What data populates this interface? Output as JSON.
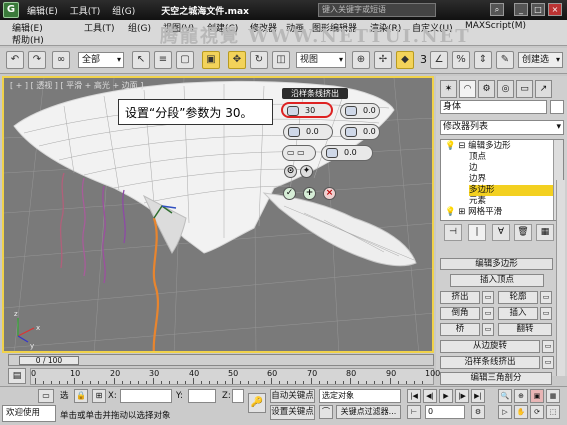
{
  "window": {
    "logo": "G",
    "menu": [
      "编辑(E)",
      "工具(T)",
      "组(G)",
      "视图(V)",
      "创建(C)",
      "修改器",
      "动画",
      "图形编辑器",
      "渲染(R)",
      "自定义(U)",
      "MAXScript(M)"
    ],
    "help_menu": "帮助(H)",
    "file_title": "天空之城海文件.max",
    "search_placeholder": "键入关键字或短语",
    "watermark": "腾龍視覺 WWW.NETTUI.NET"
  },
  "toolbar": {
    "selection_filter": "全部",
    "reference_coord": "视图",
    "snap_value": "3",
    "named_selection": "创建选"
  },
  "viewport": {
    "label": "[ + ] [ 透视 ] [ 平滑 + 高光 + 边面 ]",
    "axis_x": "x",
    "axis_y": "y",
    "axis_z": "z"
  },
  "callout": {
    "text": "设置“分段”参数为 30。"
  },
  "caddy": {
    "title": "沿样条线挤出",
    "segments": "30",
    "taper_amount": "0.0",
    "taper_curve": "0.0",
    "twist": "0.0",
    "field_x": "0.0",
    "ok_icon": "check-icon",
    "apply_icon": "plus-icon",
    "cancel_icon": "x-icon"
  },
  "command_panel": {
    "object_name": "身体",
    "modifier_list": "修改器列表",
    "stack": [
      {
        "label": "编辑多边形",
        "level": 0
      },
      {
        "label": "顶点",
        "level": 1
      },
      {
        "label": "边",
        "level": 1
      },
      {
        "label": "边界",
        "level": 1
      },
      {
        "label": "多边形",
        "level": 1,
        "selected": true
      },
      {
        "label": "元素",
        "level": 1
      },
      {
        "label": "网格平滑",
        "level": 0
      }
    ],
    "rollout_title": "编辑多边形",
    "buttons": {
      "insert_vertex": "插入顶点",
      "extrude": "挤出",
      "outline": "轮廓",
      "bevel": "倒角",
      "inset": "插入",
      "bridge": "桥",
      "flip": "翻转",
      "hinge": "从边旋转",
      "extrude_spline": "沿样条线挤出",
      "edit_tri": "编辑三角剖分"
    }
  },
  "timeline": {
    "slider": "0 / 100",
    "ticks": [
      "0",
      "10",
      "20",
      "30",
      "40",
      "50",
      "60",
      "70",
      "80",
      "90",
      "100"
    ]
  },
  "status": {
    "selected": "选",
    "x_label": "X:",
    "y_label": "Y:",
    "z_label": "Z:",
    "auto_key": "自动关键点",
    "set_key": "设置关键点",
    "selected_object": "选定对象",
    "key_filter": "关键点过滤器...",
    "frame": "0",
    "welcome": "欢迎使用",
    "prompt": "单击或单击并拖动以选择对象"
  }
}
